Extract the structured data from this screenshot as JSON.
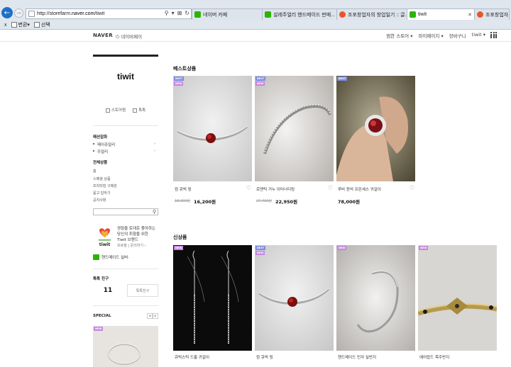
{
  "browser": {
    "url_prefix": "http://storefarm.",
    "url_host": "naver.com",
    "url_suffix": "/tiwit",
    "addr_tools": [
      "⚲",
      "▾",
      "⊠",
      "↻"
    ],
    "tabs": [
      {
        "label": "네이버 카페",
        "favicon": "green",
        "active": false
      },
      {
        "label": "설레주얼리 핸드메이드 판매...",
        "favicon": "green",
        "active": false
      },
      {
        "label": "조포창업자의 창업일기 :: 글...",
        "favicon": "orange",
        "active": false
      },
      {
        "label": "tiwit",
        "favicon": "green",
        "active": true
      },
      {
        "label": "조포창업자의",
        "favicon": "orange",
        "active": false
      }
    ],
    "cmd": {
      "close": "x",
      "convert": "변환",
      "select": "선택"
    }
  },
  "naver_bar": {
    "logo": "NAVER",
    "pay": "네이버페이",
    "menu": [
      "찜한 스토어 ▾",
      "마이페이지 ▾",
      "장바구니",
      "tiwit ▾"
    ]
  },
  "sidebar": {
    "store_name": "tiwit",
    "actions": [
      "스토어찜",
      "톡톡"
    ],
    "featured_heading": "패션잡화",
    "featured_items": [
      {
        "label": "패어쥬얼리",
        "arrow": "›"
      },
      {
        "label": "주얼리",
        "arrow": "›"
      }
    ],
    "all_heading": "전체상품",
    "plain_items": [
      "홈",
      "스페셜 상품",
      "프리미엄 구매관",
      "묻고 답하기",
      "공지사항"
    ],
    "banner_text": "경험을 토대로 좋아하는 당신의 취향을 위한 Tiwit 브랜드",
    "banner_links": "프로필 | 문의하기 ›",
    "talk_label": "핸드메이드 실버·",
    "friend_heading": "톡톡 친구",
    "friend_count": "11",
    "friend_button": "톡톡친구",
    "special_heading": "SPECIAL",
    "special_badge": "NEW"
  },
  "best": {
    "heading": "베스트상품",
    "items": [
      {
        "name": "컴 큐빅 링",
        "orig_price": "18,000원",
        "price": "16,200원",
        "badges": [
          "BEST",
          "NEW"
        ]
      },
      {
        "name": "로맨틱 거누 이터너티링",
        "orig_price": "27,400원",
        "price": "22,950원",
        "badges": [
          "BEST",
          "NEW"
        ]
      },
      {
        "name": "루비 원석 프린세스 귀걸이",
        "orig_price": "",
        "price": "78,000원",
        "badges": [
          "BEST"
        ]
      }
    ]
  },
  "new": {
    "heading": "신상품",
    "items": [
      {
        "name": "큐빅스틱 드롭 귀걸이",
        "badges": [
          "NEW"
        ]
      },
      {
        "name": "컴 큐빅 링",
        "badges": [
          "BEST",
          "NEW"
        ]
      },
      {
        "name": "핸드메이드 민자 실반지",
        "badges": [
          "NEW"
        ]
      },
      {
        "name": "에어랍드 목주반지",
        "badges": [
          "NEW"
        ]
      }
    ]
  },
  "heart_icon": "♡"
}
